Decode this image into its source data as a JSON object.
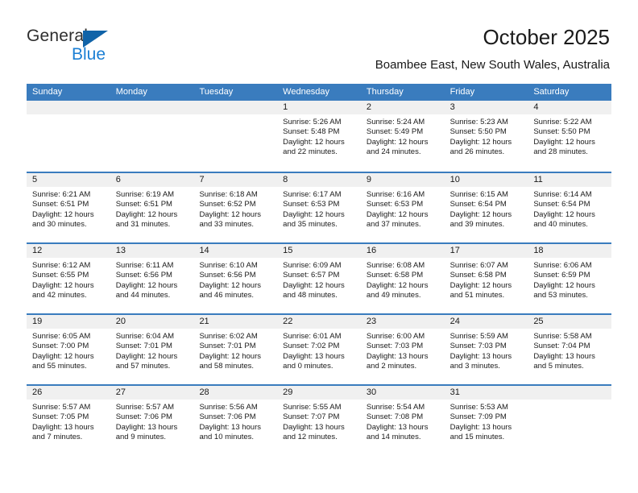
{
  "logo": {
    "word1": "General",
    "word2": "Blue",
    "triangle_color": "#1063a8",
    "blue_color": "#1b7fd4"
  },
  "header": {
    "title": "October 2025",
    "subtitle": "Boambee East, New South Wales, Australia"
  },
  "theme": {
    "header_blue": "#3a7cbe",
    "daynum_gray": "#f0f0f0",
    "text": "#1a1a1a"
  },
  "weekdays": [
    "Sunday",
    "Monday",
    "Tuesday",
    "Wednesday",
    "Thursday",
    "Friday",
    "Saturday"
  ],
  "weeks": [
    [
      {
        "day": "",
        "sunrise": "",
        "sunset": "",
        "daylight": "",
        "empty": true
      },
      {
        "day": "",
        "sunrise": "",
        "sunset": "",
        "daylight": "",
        "empty": true
      },
      {
        "day": "",
        "sunrise": "",
        "sunset": "",
        "daylight": "",
        "empty": true
      },
      {
        "day": "1",
        "sunrise": "Sunrise: 5:26 AM",
        "sunset": "Sunset: 5:48 PM",
        "daylight": "Daylight: 12 hours and 22 minutes."
      },
      {
        "day": "2",
        "sunrise": "Sunrise: 5:24 AM",
        "sunset": "Sunset: 5:49 PM",
        "daylight": "Daylight: 12 hours and 24 minutes."
      },
      {
        "day": "3",
        "sunrise": "Sunrise: 5:23 AM",
        "sunset": "Sunset: 5:50 PM",
        "daylight": "Daylight: 12 hours and 26 minutes."
      },
      {
        "day": "4",
        "sunrise": "Sunrise: 5:22 AM",
        "sunset": "Sunset: 5:50 PM",
        "daylight": "Daylight: 12 hours and 28 minutes."
      }
    ],
    [
      {
        "day": "5",
        "sunrise": "Sunrise: 6:21 AM",
        "sunset": "Sunset: 6:51 PM",
        "daylight": "Daylight: 12 hours and 30 minutes."
      },
      {
        "day": "6",
        "sunrise": "Sunrise: 6:19 AM",
        "sunset": "Sunset: 6:51 PM",
        "daylight": "Daylight: 12 hours and 31 minutes."
      },
      {
        "day": "7",
        "sunrise": "Sunrise: 6:18 AM",
        "sunset": "Sunset: 6:52 PM",
        "daylight": "Daylight: 12 hours and 33 minutes."
      },
      {
        "day": "8",
        "sunrise": "Sunrise: 6:17 AM",
        "sunset": "Sunset: 6:53 PM",
        "daylight": "Daylight: 12 hours and 35 minutes."
      },
      {
        "day": "9",
        "sunrise": "Sunrise: 6:16 AM",
        "sunset": "Sunset: 6:53 PM",
        "daylight": "Daylight: 12 hours and 37 minutes."
      },
      {
        "day": "10",
        "sunrise": "Sunrise: 6:15 AM",
        "sunset": "Sunset: 6:54 PM",
        "daylight": "Daylight: 12 hours and 39 minutes."
      },
      {
        "day": "11",
        "sunrise": "Sunrise: 6:14 AM",
        "sunset": "Sunset: 6:54 PM",
        "daylight": "Daylight: 12 hours and 40 minutes."
      }
    ],
    [
      {
        "day": "12",
        "sunrise": "Sunrise: 6:12 AM",
        "sunset": "Sunset: 6:55 PM",
        "daylight": "Daylight: 12 hours and 42 minutes."
      },
      {
        "day": "13",
        "sunrise": "Sunrise: 6:11 AM",
        "sunset": "Sunset: 6:56 PM",
        "daylight": "Daylight: 12 hours and 44 minutes."
      },
      {
        "day": "14",
        "sunrise": "Sunrise: 6:10 AM",
        "sunset": "Sunset: 6:56 PM",
        "daylight": "Daylight: 12 hours and 46 minutes."
      },
      {
        "day": "15",
        "sunrise": "Sunrise: 6:09 AM",
        "sunset": "Sunset: 6:57 PM",
        "daylight": "Daylight: 12 hours and 48 minutes."
      },
      {
        "day": "16",
        "sunrise": "Sunrise: 6:08 AM",
        "sunset": "Sunset: 6:58 PM",
        "daylight": "Daylight: 12 hours and 49 minutes."
      },
      {
        "day": "17",
        "sunrise": "Sunrise: 6:07 AM",
        "sunset": "Sunset: 6:58 PM",
        "daylight": "Daylight: 12 hours and 51 minutes."
      },
      {
        "day": "18",
        "sunrise": "Sunrise: 6:06 AM",
        "sunset": "Sunset: 6:59 PM",
        "daylight": "Daylight: 12 hours and 53 minutes."
      }
    ],
    [
      {
        "day": "19",
        "sunrise": "Sunrise: 6:05 AM",
        "sunset": "Sunset: 7:00 PM",
        "daylight": "Daylight: 12 hours and 55 minutes."
      },
      {
        "day": "20",
        "sunrise": "Sunrise: 6:04 AM",
        "sunset": "Sunset: 7:01 PM",
        "daylight": "Daylight: 12 hours and 57 minutes."
      },
      {
        "day": "21",
        "sunrise": "Sunrise: 6:02 AM",
        "sunset": "Sunset: 7:01 PM",
        "daylight": "Daylight: 12 hours and 58 minutes."
      },
      {
        "day": "22",
        "sunrise": "Sunrise: 6:01 AM",
        "sunset": "Sunset: 7:02 PM",
        "daylight": "Daylight: 13 hours and 0 minutes."
      },
      {
        "day": "23",
        "sunrise": "Sunrise: 6:00 AM",
        "sunset": "Sunset: 7:03 PM",
        "daylight": "Daylight: 13 hours and 2 minutes."
      },
      {
        "day": "24",
        "sunrise": "Sunrise: 5:59 AM",
        "sunset": "Sunset: 7:03 PM",
        "daylight": "Daylight: 13 hours and 3 minutes."
      },
      {
        "day": "25",
        "sunrise": "Sunrise: 5:58 AM",
        "sunset": "Sunset: 7:04 PM",
        "daylight": "Daylight: 13 hours and 5 minutes."
      }
    ],
    [
      {
        "day": "26",
        "sunrise": "Sunrise: 5:57 AM",
        "sunset": "Sunset: 7:05 PM",
        "daylight": "Daylight: 13 hours and 7 minutes."
      },
      {
        "day": "27",
        "sunrise": "Sunrise: 5:57 AM",
        "sunset": "Sunset: 7:06 PM",
        "daylight": "Daylight: 13 hours and 9 minutes."
      },
      {
        "day": "28",
        "sunrise": "Sunrise: 5:56 AM",
        "sunset": "Sunset: 7:06 PM",
        "daylight": "Daylight: 13 hours and 10 minutes."
      },
      {
        "day": "29",
        "sunrise": "Sunrise: 5:55 AM",
        "sunset": "Sunset: 7:07 PM",
        "daylight": "Daylight: 13 hours and 12 minutes."
      },
      {
        "day": "30",
        "sunrise": "Sunrise: 5:54 AM",
        "sunset": "Sunset: 7:08 PM",
        "daylight": "Daylight: 13 hours and 14 minutes."
      },
      {
        "day": "31",
        "sunrise": "Sunrise: 5:53 AM",
        "sunset": "Sunset: 7:09 PM",
        "daylight": "Daylight: 13 hours and 15 minutes."
      },
      {
        "day": "",
        "sunrise": "",
        "sunset": "",
        "daylight": "",
        "empty": true
      }
    ]
  ]
}
